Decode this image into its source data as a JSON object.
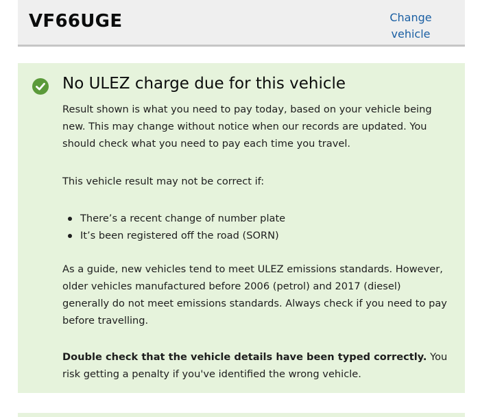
{
  "vehicle": {
    "registration": "VF66UGE",
    "change_link_label": "Change vehicle"
  },
  "result": {
    "status_icon": "check-circle-icon",
    "status_color": "#5b9a3a",
    "panel_color": "#e6f3dc",
    "title": "No ULEZ charge due for this vehicle",
    "paragraph_1": "Result shown is what you need to pay today, based on your vehicle being new. This may change without notice when our records are updated. You should check what you need to pay each time you travel.",
    "paragraph_2": "This vehicle result may not be correct if:",
    "bullets": [
      "There’s a recent change of number plate",
      "It’s been registered off the road (SORN)"
    ],
    "paragraph_3": "As a guide, new vehicles tend to meet ULEZ emissions standards. However, older vehicles manufactured before 2006 (petrol) and 2017 (diesel) generally do not meet emissions standards. Always check if you need to pay before travelling.",
    "warning_bold": "Double check that the vehicle details have been typed correctly.",
    "warning_rest": " You risk getting a penalty if you've identified the wrong vehicle."
  },
  "link_color": "#1a5fa3"
}
